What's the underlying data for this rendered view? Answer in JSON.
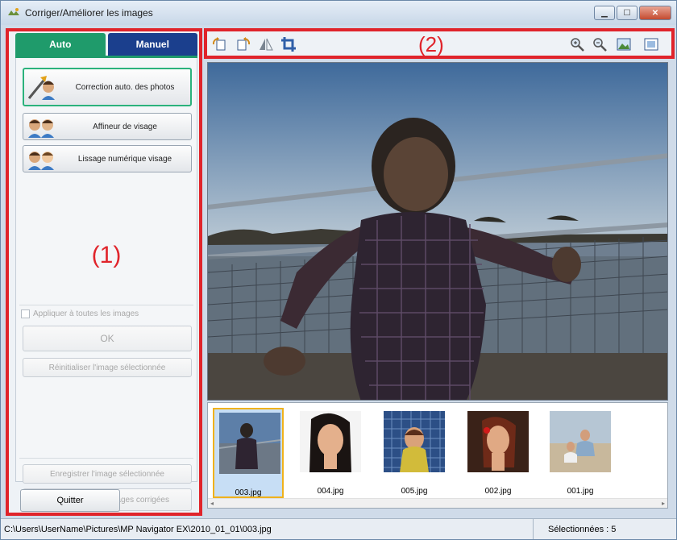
{
  "window": {
    "title": "Corriger/Améliorer les images"
  },
  "tabs": [
    {
      "label": "Auto",
      "active": true
    },
    {
      "label": "Manuel",
      "active": false
    }
  ],
  "left_panel": {
    "buttons": {
      "auto_correct": "Correction auto. des photos",
      "face_sharpener": "Affineur de visage",
      "digital_face_smoothing": "Lissage numérique visage"
    },
    "region_label": "(1)",
    "apply_all_label": "Appliquer à toutes les images",
    "ok_label": "OK",
    "reset_label": "Réinitialiser l'image sélectionnée",
    "save_selected_label": "Enregistrer l'image sélectionnée",
    "save_all_label": "Enreg. toutes les images corrigées",
    "quit_label": "Quitter"
  },
  "toolbar": {
    "region_label": "(2)"
  },
  "thumbnails": [
    {
      "name": "003.jpg",
      "selected": true
    },
    {
      "name": "004.jpg",
      "selected": false
    },
    {
      "name": "005.jpg",
      "selected": false
    },
    {
      "name": "002.jpg",
      "selected": false
    },
    {
      "name": "001.jpg",
      "selected": false
    }
  ],
  "status": {
    "path": "C:\\Users\\UserName\\Pictures\\MP Navigator EX\\2010_01_01\\003.jpg",
    "selected": "Sélectionnées : 5"
  },
  "colors": {
    "highlight_red": "#e0242b",
    "auto_tab": "#1f9b6b",
    "manual_tab": "#1b3f8d"
  }
}
